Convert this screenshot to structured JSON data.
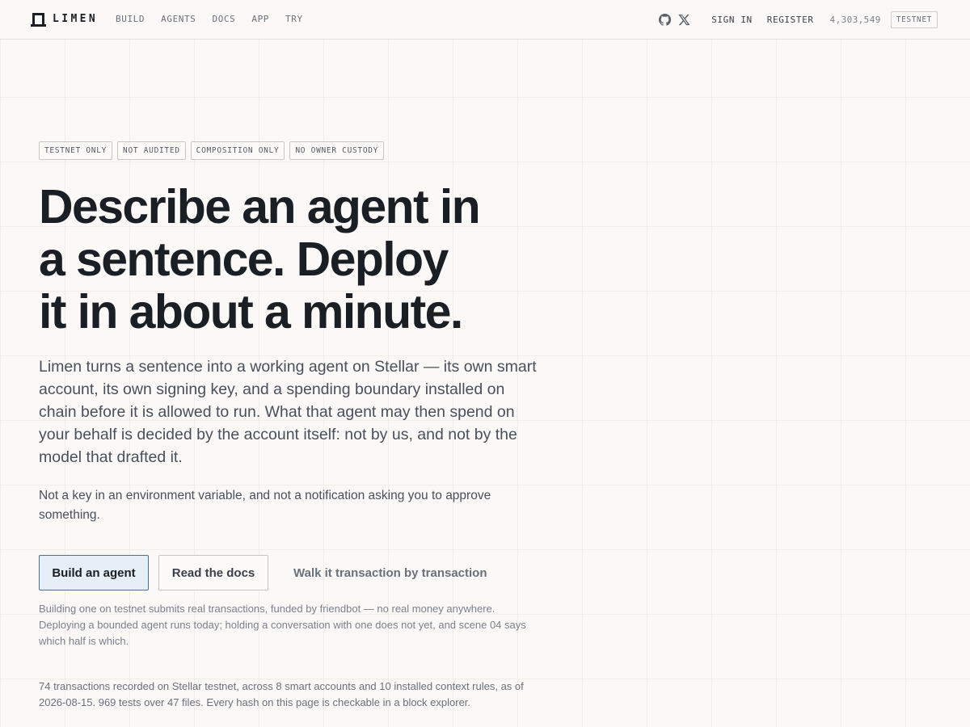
{
  "header": {
    "brand": "LIMEN",
    "nav": [
      "BUILD",
      "AGENTS",
      "DOCS",
      "APP",
      "TRY"
    ],
    "icons": [
      "github-icon",
      "x-icon"
    ],
    "sign_in": "SIGN IN",
    "register": "REGISTER",
    "counter": "4,303,549",
    "network": "TESTNET"
  },
  "hero": {
    "tags": [
      "TESTNET ONLY",
      "NOT AUDITED",
      "COMPOSITION ONLY",
      "NO OWNER CUSTODY"
    ],
    "headline_lines": [
      "Describe an agent in",
      "a sentence. Deploy",
      "it in about a minute."
    ],
    "lede": "Limen turns a sentence into a working agent on Stellar — its own smart account, its own signing key, and a spending boundary installed on chain before it is allowed to run. What that agent may then spend on your behalf is decided by the account itself: not by us, and not by the model that drafted it.",
    "sub": "Not a key in an environment variable, and not a notification asking you to approve something.",
    "primary_cta": "Build an agent",
    "secondary_cta": "Read the docs",
    "tertiary_cta": "Walk it transaction by transaction",
    "fine_print": "Building one on testnet submits real transactions, funded by friendbot — no real money anywhere. Deploying a bounded agent runs today; holding a conversation with one does not yet, and scene 04 says which half is which.",
    "stats": "74 transactions recorded on Stellar testnet, across 8 smart accounts and 10 installed context rules, as of 2026-08-15. 969 tests over 47 files. Every hash on this page is checkable in a block explorer."
  },
  "colors": {
    "background": "#faf9f7",
    "primary_button_fill": "#e6eef7",
    "primary_button_border": "#4d6e8f",
    "text": "#1b1e23"
  }
}
